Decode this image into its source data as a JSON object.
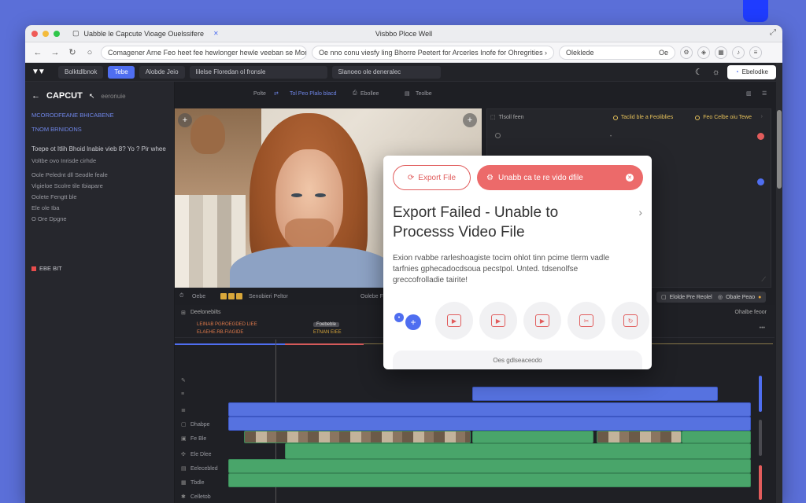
{
  "browser": {
    "tab_title": "Uabble le Capcute Vioage Ouelssifere",
    "window_title": "Visbbo Ploce Well",
    "url1": "Comagener Arne Feo heet fee hewlonger hewle veeban se Morne",
    "url2": "Oe nno conu viesfy ling Bhorre Peetert for Arcerles Inofe for Ohregrities",
    "url3": "Oleklede",
    "toolbar_text": "Oe"
  },
  "app_bar": {
    "item1": "Bolktdlbnok",
    "item2": "Tebe",
    "item3": "Alobde Jeio",
    "item4": "Iilelse Floredan ol fronsle",
    "item5": "Slanoeo ole deneralec",
    "share": "Ebelodke"
  },
  "left_panel": {
    "brand": "CAPCUT",
    "brand_sub": "eeronuie",
    "link1": "MCORODFEANE BHICABENE",
    "link2": "TNOM BRNIDONS",
    "heading": "Toepe ot Itlih Bhoid lnabie vieb 8? Yo ? Pir whee",
    "sub1": "Voltbe ovo Inrisde cirhde",
    "item1": "Oole Pelednt dll  Seodle feale",
    "item2": "Vigieloe Scolre tile Ibiapare",
    "item3": "Oolete Fengtt ble",
    "item4": "Ele ole Iba",
    "item5": "O  Ore Dpgne",
    "badge": "EBE BIT"
  },
  "preview_header": {
    "center1": "Polte",
    "center2": "Tol Peo Plalo blacd",
    "center3": "Ebollee",
    "center4": "Teolbe"
  },
  "right_panel": {
    "label": "Tlsoll feen",
    "tag1": "Taclid ble a Feoliblies",
    "tag2": "Feo Celbe oiu Tewe"
  },
  "mid_toolbar": {
    "left": "Oebe",
    "label": "Senobieri Peltor",
    "center": "Oolebe Fdle",
    "chip1": "Elolde Pre Reolel",
    "chip2": "Obale Peao"
  },
  "timeline": {
    "header": "Deelonebilts",
    "tag1": "LEINAB PGROEGDED LIEE",
    "tag2": "ELAEHE.RB.FIAGIDE",
    "tag3_top": "Foebeble",
    "tag3": "ETNAN EIEE",
    "right": "Ohalbe feoor",
    "tracks": [
      "",
      "",
      "",
      "Dhabpe",
      "Fe Ble",
      "Ele Dlee",
      "Eelecebled",
      "Tbdle",
      "Celletob"
    ]
  },
  "dialog": {
    "btn_outline": "Export File",
    "btn_solid": "Unabb ca te re vido dfile",
    "title": "Export Failed - Unable to Processs Video File",
    "body": "Exion rvabbe rarleshoagiste tocim ohlot tinn pcime tlerm vadle tarfnies gphecadocdsoua pecstpol. Unted. tdsenolfse greccofrolladie tairite!",
    "footer": "Oes gdlseaceodo",
    "icons": [
      "play-icon",
      "play-icon",
      "play-icon",
      "crop-icon",
      "rotate-icon"
    ]
  }
}
